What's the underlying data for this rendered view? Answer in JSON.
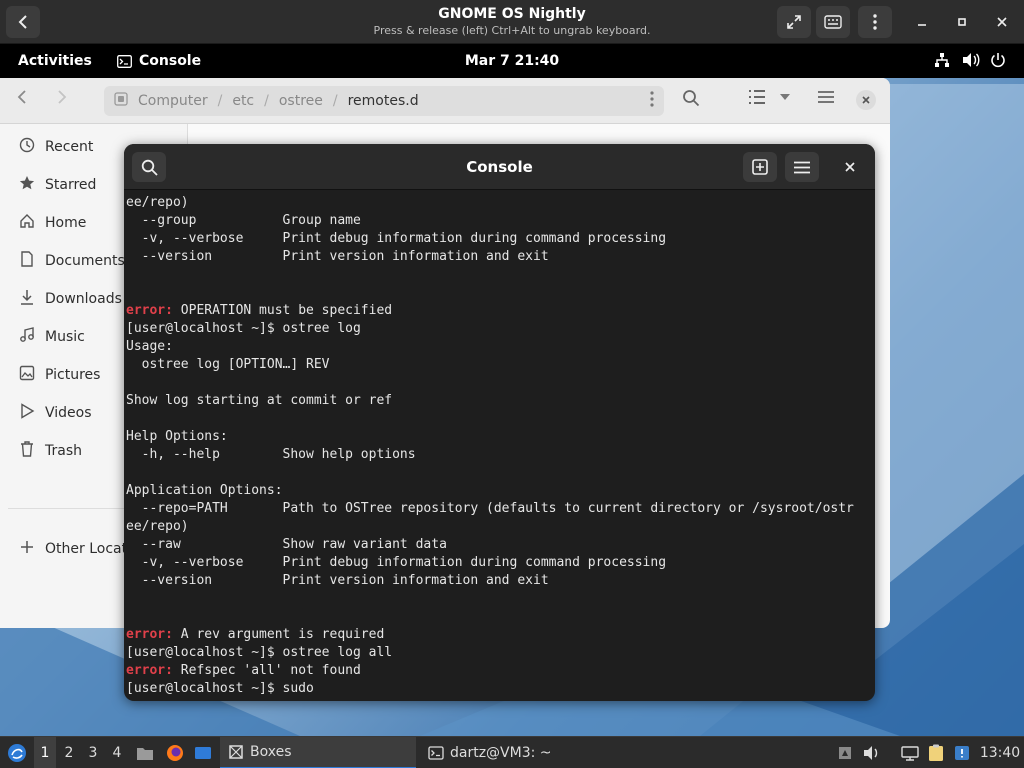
{
  "boxes": {
    "title": "GNOME OS Nightly",
    "subtitle": "Press & release (left) Ctrl+Alt to ungrab keyboard."
  },
  "gnome_topbar": {
    "activities": "Activities",
    "app_name": "Console",
    "clock": "Mar 7  21:40"
  },
  "files": {
    "path": [
      "Computer",
      "etc",
      "ostree",
      "remotes.d"
    ],
    "sidebar": [
      {
        "label": "Recent",
        "icon": "clock-icon"
      },
      {
        "label": "Starred",
        "icon": "star-icon"
      },
      {
        "label": "Home",
        "icon": "home-icon"
      },
      {
        "label": "Documents",
        "icon": "document-icon"
      },
      {
        "label": "Downloads",
        "icon": "download-icon"
      },
      {
        "label": "Music",
        "icon": "music-icon"
      },
      {
        "label": "Pictures",
        "icon": "picture-icon"
      },
      {
        "label": "Videos",
        "icon": "video-icon"
      },
      {
        "label": "Trash",
        "icon": "trash-icon"
      },
      {
        "label": "Other Locati",
        "icon": "plus-icon"
      }
    ]
  },
  "console": {
    "title": "Console",
    "lines": [
      {
        "text": "ee/repo)"
      },
      {
        "text": "  --group           Group name"
      },
      {
        "text": "  -v, --verbose     Print debug information during command processing"
      },
      {
        "text": "  --version         Print version information and exit"
      },
      {
        "text": ""
      },
      {
        "text": ""
      },
      {
        "error": "error:",
        "text": " OPERATION must be specified"
      },
      {
        "text": "[user@localhost ~]$ ostree log"
      },
      {
        "text": "Usage:"
      },
      {
        "text": "  ostree log [OPTION…] REV"
      },
      {
        "text": ""
      },
      {
        "text": "Show log starting at commit or ref"
      },
      {
        "text": ""
      },
      {
        "text": "Help Options:"
      },
      {
        "text": "  -h, --help        Show help options"
      },
      {
        "text": ""
      },
      {
        "text": "Application Options:"
      },
      {
        "text": "  --repo=PATH       Path to OSTree repository (defaults to current directory or /sysroot/ostr"
      },
      {
        "text": "ee/repo)"
      },
      {
        "text": "  --raw             Show raw variant data"
      },
      {
        "text": "  -v, --verbose     Print debug information during command processing"
      },
      {
        "text": "  --version         Print version information and exit"
      },
      {
        "text": ""
      },
      {
        "text": ""
      },
      {
        "error": "error:",
        "text": " A rev argument is required"
      },
      {
        "text": "[user@localhost ~]$ ostree log all"
      },
      {
        "error": "error:",
        "text": " Refspec 'all' not found"
      },
      {
        "text": "[user@localhost ~]$ sudo"
      }
    ]
  },
  "taskbar": {
    "workspaces": [
      "1",
      "2",
      "3",
      "4"
    ],
    "tasks": [
      {
        "label": "Boxes"
      },
      {
        "label": "dartz@VM3: ~"
      }
    ],
    "time": "13:40"
  }
}
